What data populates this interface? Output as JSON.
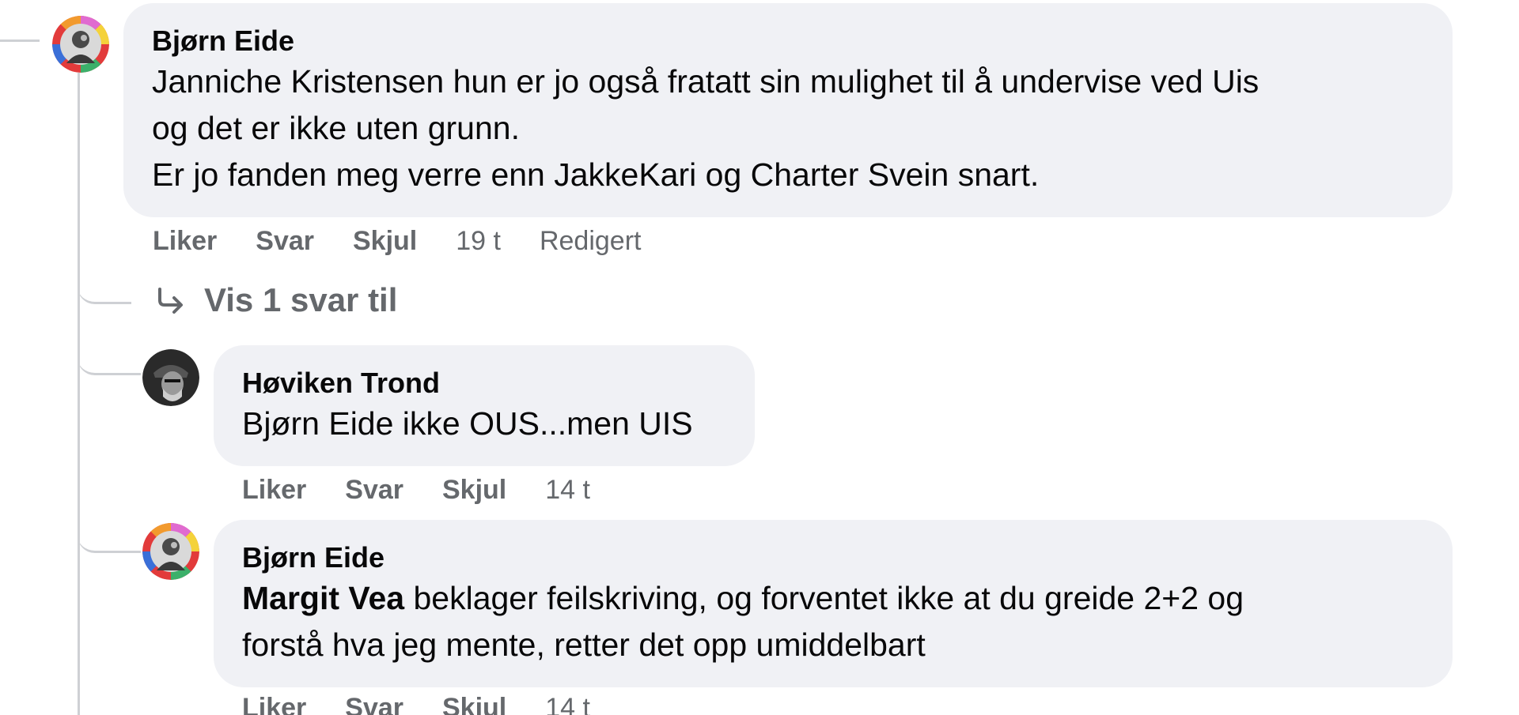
{
  "comments": [
    {
      "author": "Bjørn Eide",
      "text_line1": "Janniche Kristensen hun er jo også fratatt sin mulighet til å undervise ved Uis",
      "text_line2": "og det er ikke uten grunn.",
      "text_line3": "Er jo fanden meg verre enn JakkeKari og Charter Svein snart.",
      "actions": {
        "like": "Liker",
        "reply": "Svar",
        "hide": "Skjul",
        "time": "19 t",
        "edited": "Redigert"
      }
    },
    {
      "author": "Høviken Trond",
      "text": "Bjørn Eide ikke OUS...men UIS",
      "actions": {
        "like": "Liker",
        "reply": "Svar",
        "hide": "Skjul",
        "time": "14 t"
      }
    },
    {
      "author": "Bjørn Eide",
      "mention": "Margit Vea",
      "text_line1": " beklager feilskriving, og forventet ikke at du greide 2+2 og",
      "text_line2": "forstå hva jeg mente, retter det opp umiddelbart",
      "actions": {
        "like": "Liker",
        "reply": "Svar",
        "hide": "Skjul",
        "time": "14 t"
      }
    }
  ],
  "more_replies": {
    "label": "Vis 1 svar til",
    "icon": "reply-arrow-icon"
  },
  "colors": {
    "bubble": "#f0f1f5",
    "text": "#080809",
    "secondary": "#65686c",
    "connector": "#ced0d4"
  }
}
